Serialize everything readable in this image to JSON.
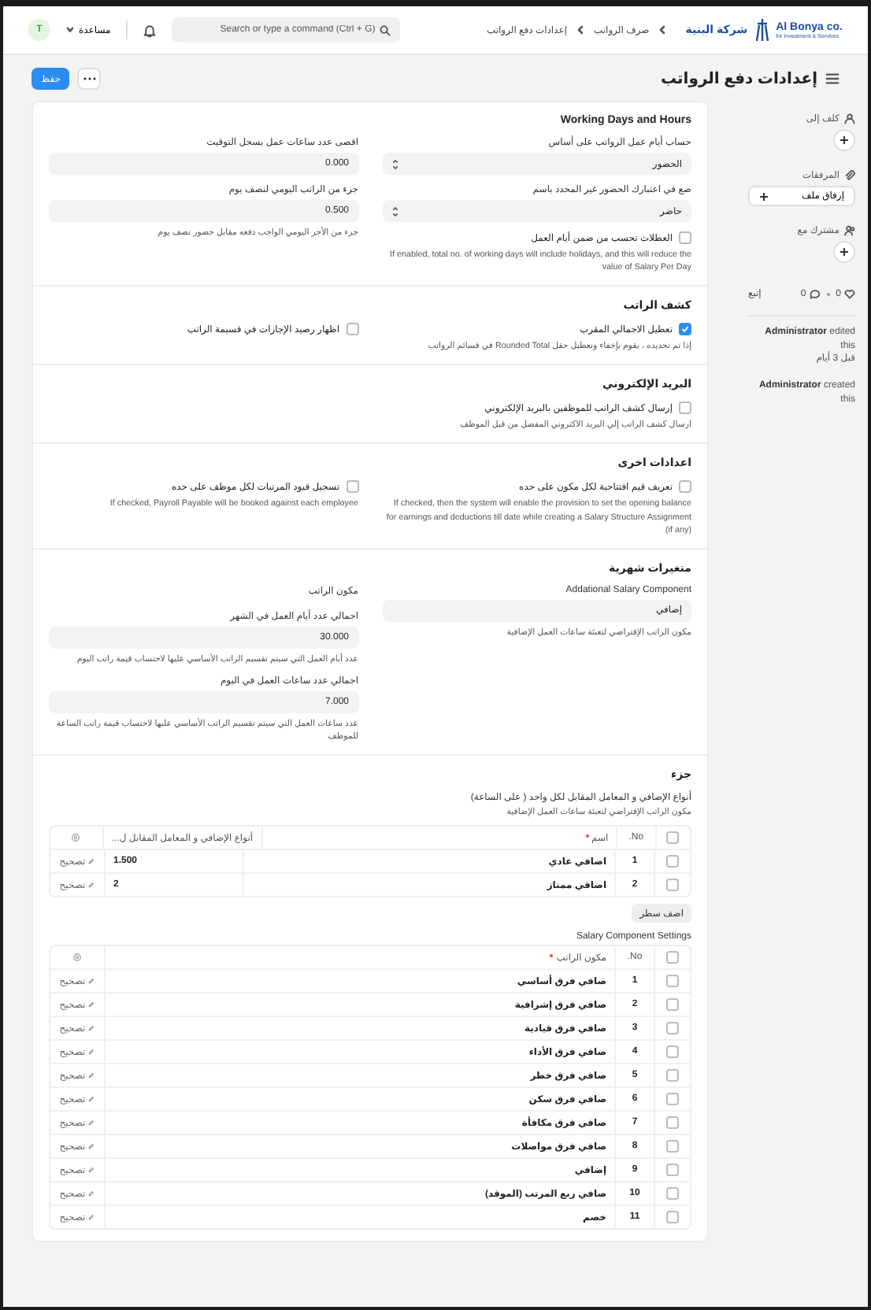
{
  "navbar": {
    "logo_latin": "Al Bonya co.",
    "logo_tagline": "for Investment & Services",
    "logo_arabic": "شركة البنية",
    "breadcrumbs": [
      "صرف الرواتب",
      "إعدادات دفع الرواتب"
    ],
    "search": {
      "placeholder": "Search or type a command (Ctrl + G)"
    },
    "help": "مساعدة",
    "avatar": "T"
  },
  "page": {
    "title": "إعدادات دفع الرواتب",
    "save": "حفظ"
  },
  "sidebar": {
    "assign": "كلف إلى",
    "attachments": "المرفقات",
    "attach_button": "إرفاق ملف",
    "shared": "مشترك مع",
    "likes": "0",
    "comments": "0",
    "follow": "إتبع",
    "activity": [
      {
        "text": "**Administrator** edited this",
        "time": "قبل 3 أيام"
      },
      {
        "text": "**Administrator** created this"
      }
    ]
  },
  "sections": [
    {
      "title": "Working Days and Hours",
      "columns": [
        [
          {
            "kind": "select",
            "label": "حساب أيام عمل الرواتب على أساس",
            "value": "الحضور"
          },
          {
            "kind": "select",
            "label": "ضع في اعتبارك الحضور غير المحدد باسم",
            "value": "حاضر"
          },
          {
            "kind": "check",
            "label": "العطلات تحسب من ضمن أيام العمل",
            "checked": false,
            "description": "If enabled, total no. of working days will include holidays, and this will reduce the value of Salary Per Day"
          }
        ],
        [
          {
            "kind": "number",
            "label": "اقصى عدد ساعات عمل بسجل التوقيت",
            "value": "0.000"
          },
          {
            "kind": "number",
            "label": "جزء من الراتب اليومي لنصف يوم",
            "value": "0.500",
            "description": "جزء من الأجر اليومي الواجب دفعه مقابل حضور نصف يوم"
          }
        ]
      ]
    },
    {
      "title": "كشف الراتب",
      "columns": [
        [
          {
            "kind": "check",
            "label": "تعطيل الاجمالي المقرب",
            "checked": true,
            "description": "إذا تم تحديده ، يقوم بإخفاء وتعطيل حقل Rounded Total في قسائم الرواتب"
          }
        ],
        [
          {
            "kind": "check",
            "label": "اظهار رصيد الإجازات في قسيمة الراتب",
            "checked": false
          }
        ]
      ]
    },
    {
      "title": "البريد الإلكتروني",
      "columns": [
        [
          {
            "kind": "check",
            "label": "إرسال كشف الراتب للموظفين بالبريد الإلكتروني",
            "checked": false,
            "description": "ارسال كشف الراتب إلي البريد الاكتروني المفضل من قبل الموظف"
          }
        ],
        []
      ]
    },
    {
      "title": "اعدادات اخرى",
      "columns": [
        [
          {
            "kind": "check",
            "label": "تعريف قيم افتتاحية لكل مكون على حده",
            "checked": false,
            "description": "If checked, then the system will enable the provision to set the opening balance for earnings and deductions till date while creating a Salary Structure Assignment (if any)"
          }
        ],
        [
          {
            "kind": "check",
            "label": "تسجيل قيود المرتبات لكل موظف على حده",
            "checked": false,
            "description": "If checked, Payroll Payable will be booked against each employee"
          }
        ]
      ]
    },
    {
      "title": "متغيرات شهرية",
      "columns": [
        [
          {
            "kind": "link",
            "label": "Addational Salary Component",
            "value": "إضافي",
            "description": "مكون الراتب الإفتراضي لتعبئة ساعات العمل الإضافية"
          }
        ],
        [
          {
            "kind": "label",
            "label": "مكون الراتب"
          },
          {
            "kind": "number",
            "label": "اجمالي عدد أيام العمل في الشهر",
            "value": "30.000",
            "description": "عدد أيام العمل التي سيتم تقسيم الراتب الأساسي عليها لاحتساب قيمة راتب اليوم"
          },
          {
            "kind": "number",
            "label": "اجمالي عدد ساعات العمل في اليوم",
            "value": "7.000",
            "description": "عدد ساعات العمل التي سيتم تقسيم الراتب الأساسي عليها لاحتساب قيمة راتب الساعة للموظف"
          }
        ]
      ]
    }
  ],
  "part": {
    "title": "جزء",
    "tables": [
      {
        "label": "أنواع الإضافي و المعامل المقابل لكل واحد ( على الساعة)",
        "description": "مكون الراتب الإفتراضي لتعبئة ساعات العمل الإضافية",
        "all_checked": false,
        "columns": [
          {
            "label": "No.",
            "required": false
          },
          {
            "label": "اسم",
            "required": true
          },
          {
            "label": "أنواع الإضافي و المعامل المقابل ل...",
            "required": false
          }
        ],
        "rows": [
          {
            "checked": false,
            "cells": [
              "1",
              "اضافي عادي",
              "1.500"
            ],
            "edit": "تصحيح"
          },
          {
            "checked": false,
            "cells": [
              "2",
              "اضافي ممتاز",
              "2"
            ],
            "edit": "تصحيح"
          }
        ],
        "add_row": "اضف سطر"
      },
      {
        "label": "Salary Component Settings",
        "all_checked": false,
        "columns": [
          {
            "label": "No.",
            "required": false
          },
          {
            "label": "مكون الراتب",
            "required": true
          }
        ],
        "rows": [
          {
            "checked": false,
            "cells": [
              "1",
              "صافي فرق أساسي"
            ],
            "edit": "تصحيح"
          },
          {
            "checked": false,
            "cells": [
              "2",
              "صافي فرق إشرافية"
            ],
            "edit": "تصحيح"
          },
          {
            "checked": false,
            "cells": [
              "3",
              "صافي فرق قيادية"
            ],
            "edit": "تصحيح"
          },
          {
            "checked": false,
            "cells": [
              "4",
              "صافي فرق الأداء"
            ],
            "edit": "تصحيح"
          },
          {
            "checked": false,
            "cells": [
              "5",
              "صافي فرق خطر"
            ],
            "edit": "تصحيح"
          },
          {
            "checked": false,
            "cells": [
              "6",
              "صافي فرق سكن"
            ],
            "edit": "تصحيح"
          },
          {
            "checked": false,
            "cells": [
              "7",
              "صافي فرق مكافأة"
            ],
            "edit": "تصحيح"
          },
          {
            "checked": false,
            "cells": [
              "8",
              "صافي فرق مواصلات"
            ],
            "edit": "تصحيح"
          },
          {
            "checked": false,
            "cells": [
              "9",
              "إضافي"
            ],
            "edit": "تصحيح"
          },
          {
            "checked": false,
            "cells": [
              "10",
              "صافي ربع المرتب (الموقد)"
            ],
            "edit": "تصحيح"
          },
          {
            "checked": false,
            "cells": [
              "11",
              "خصم"
            ],
            "edit": "تصحيح"
          }
        ]
      }
    ]
  }
}
